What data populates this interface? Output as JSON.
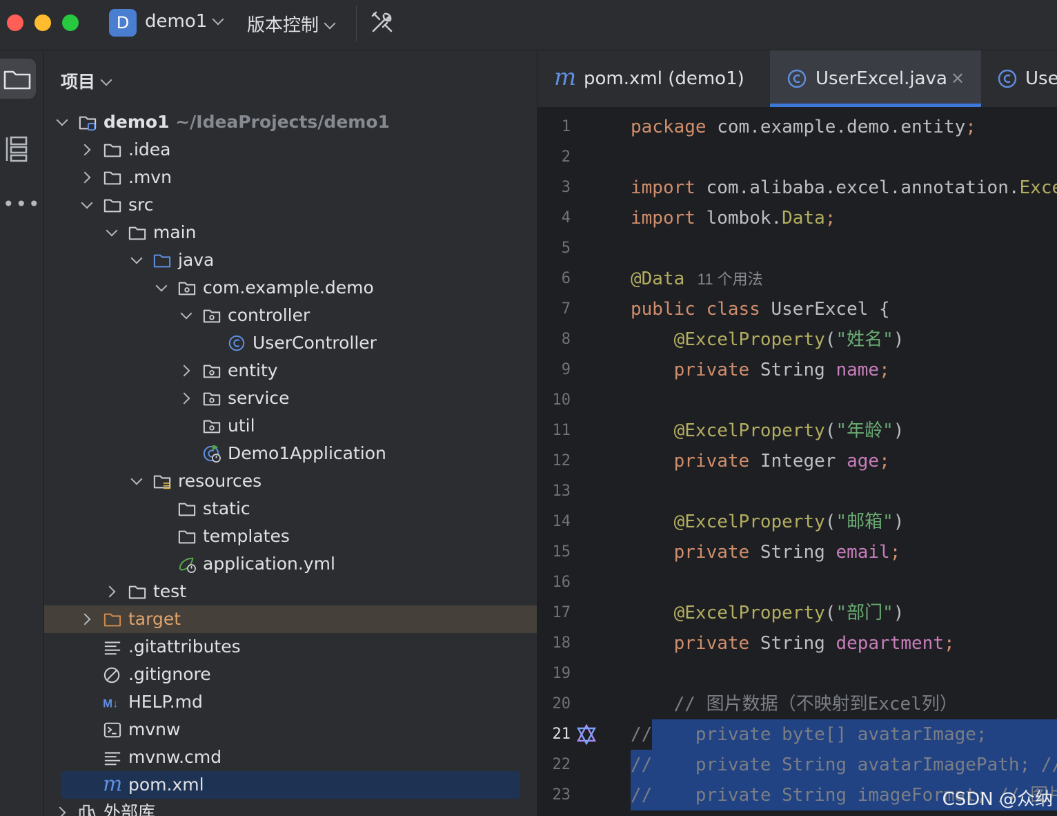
{
  "titlebar": {
    "project_badge": "D",
    "project_name": "demo1",
    "vcs_label": "版本控制"
  },
  "panel": {
    "title": "项目",
    "tree": [
      {
        "label": "demo1",
        "extra": " ~/IdeaProjects/demo1",
        "indent": 0,
        "arrow": "open",
        "icon": "module-folder"
      },
      {
        "label": ".idea",
        "indent": 1,
        "arrow": "closed",
        "icon": "folder"
      },
      {
        "label": ".mvn",
        "indent": 1,
        "arrow": "closed",
        "icon": "folder"
      },
      {
        "label": "src",
        "indent": 1,
        "arrow": "open",
        "icon": "folder"
      },
      {
        "label": "main",
        "indent": 2,
        "arrow": "open",
        "icon": "folder"
      },
      {
        "label": "java",
        "indent": 3,
        "arrow": "open",
        "icon": "source-folder"
      },
      {
        "label": "com.example.demo",
        "indent": 4,
        "arrow": "open",
        "icon": "package"
      },
      {
        "label": "controller",
        "indent": 5,
        "arrow": "open",
        "icon": "package"
      },
      {
        "label": "UserController",
        "indent": 6,
        "arrow": "none",
        "icon": "class"
      },
      {
        "label": "entity",
        "indent": 5,
        "arrow": "closed",
        "icon": "package"
      },
      {
        "label": "service",
        "indent": 5,
        "arrow": "closed",
        "icon": "package"
      },
      {
        "label": "util",
        "indent": 5,
        "arrow": "none",
        "icon": "package"
      },
      {
        "label": "Demo1Application",
        "indent": 5,
        "arrow": "none",
        "icon": "app-class"
      },
      {
        "label": "resources",
        "indent": 3,
        "arrow": "open",
        "icon": "resources-folder"
      },
      {
        "label": "static",
        "indent": 4,
        "arrow": "none",
        "icon": "folder"
      },
      {
        "label": "templates",
        "indent": 4,
        "arrow": "none",
        "icon": "folder"
      },
      {
        "label": "application.yml",
        "indent": 4,
        "arrow": "none",
        "icon": "spring-config"
      },
      {
        "label": "test",
        "indent": 2,
        "arrow": "closed",
        "icon": "folder"
      },
      {
        "label": "target",
        "indent": 1,
        "arrow": "closed",
        "icon": "excluded-folder"
      },
      {
        "label": ".gitattributes",
        "indent": 1,
        "arrow": "none",
        "icon": "text-file"
      },
      {
        "label": ".gitignore",
        "indent": 1,
        "arrow": "none",
        "icon": "ignore-file"
      },
      {
        "label": "HELP.md",
        "indent": 1,
        "arrow": "none",
        "icon": "markdown"
      },
      {
        "label": "mvnw",
        "indent": 1,
        "arrow": "none",
        "icon": "shell-script"
      },
      {
        "label": "mvnw.cmd",
        "indent": 1,
        "arrow": "none",
        "icon": "text-file"
      },
      {
        "label": "pom.xml",
        "indent": 1,
        "arrow": "none",
        "icon": "maven"
      },
      {
        "label": "外部库",
        "indent": 0,
        "arrow": "closed",
        "icon": "library"
      }
    ]
  },
  "editor": {
    "tabs": [
      {
        "label": "pom.xml (demo1)",
        "icon": "maven-icon"
      },
      {
        "label": "UserExcel.java",
        "icon": "class-icon",
        "active": true
      },
      {
        "label": "Use",
        "icon": "class-icon"
      }
    ],
    "code_lines": [
      {
        "n": "1",
        "tokens": [
          [
            "kw",
            "package"
          ],
          [
            "pl",
            " com.example.demo.entity"
          ],
          [
            "kw",
            ";"
          ]
        ]
      },
      {
        "n": "2",
        "tokens": []
      },
      {
        "n": "3",
        "tokens": [
          [
            "kw",
            "import"
          ],
          [
            "pl",
            " com.alibaba.excel.annotation."
          ],
          [
            "an",
            "Exce"
          ]
        ]
      },
      {
        "n": "4",
        "tokens": [
          [
            "kw",
            "import"
          ],
          [
            "pl",
            " lombok."
          ],
          [
            "an",
            "Data"
          ],
          [
            "kw",
            ";"
          ]
        ]
      },
      {
        "n": "5",
        "tokens": []
      },
      {
        "n": "6",
        "tokens": [
          [
            "an",
            "@Data"
          ],
          [
            "hint",
            "   11 个用法"
          ]
        ]
      },
      {
        "n": "7",
        "tokens": [
          [
            "kw",
            "public class"
          ],
          [
            "pl",
            " UserExcel {"
          ]
        ]
      },
      {
        "n": "8",
        "tokens": [
          [
            "pl",
            "    "
          ],
          [
            "an",
            "@ExcelProperty"
          ],
          [
            "pl",
            "("
          ],
          [
            "str",
            "\"姓名\""
          ],
          [
            "pl",
            ")"
          ]
        ]
      },
      {
        "n": "9",
        "tokens": [
          [
            "pl",
            "    "
          ],
          [
            "kw",
            "private"
          ],
          [
            "pl",
            " String "
          ],
          [
            "fld",
            "name"
          ],
          [
            "kw",
            ";"
          ]
        ]
      },
      {
        "n": "10",
        "tokens": []
      },
      {
        "n": "11",
        "tokens": [
          [
            "pl",
            "    "
          ],
          [
            "an",
            "@ExcelProperty"
          ],
          [
            "pl",
            "("
          ],
          [
            "str",
            "\"年龄\""
          ],
          [
            "pl",
            ")"
          ]
        ]
      },
      {
        "n": "12",
        "tokens": [
          [
            "pl",
            "    "
          ],
          [
            "kw",
            "private"
          ],
          [
            "pl",
            " Integer "
          ],
          [
            "fld",
            "age"
          ],
          [
            "kw",
            ";"
          ]
        ]
      },
      {
        "n": "13",
        "tokens": []
      },
      {
        "n": "14",
        "tokens": [
          [
            "pl",
            "    "
          ],
          [
            "an",
            "@ExcelProperty"
          ],
          [
            "pl",
            "("
          ],
          [
            "str",
            "\"邮箱\""
          ],
          [
            "pl",
            ")"
          ]
        ]
      },
      {
        "n": "15",
        "tokens": [
          [
            "pl",
            "    "
          ],
          [
            "kw",
            "private"
          ],
          [
            "pl",
            " String "
          ],
          [
            "fld",
            "email"
          ],
          [
            "kw",
            ";"
          ]
        ]
      },
      {
        "n": "16",
        "tokens": []
      },
      {
        "n": "17",
        "tokens": [
          [
            "pl",
            "    "
          ],
          [
            "an",
            "@ExcelProperty"
          ],
          [
            "pl",
            "("
          ],
          [
            "str",
            "\"部门\""
          ],
          [
            "pl",
            ")"
          ]
        ]
      },
      {
        "n": "18",
        "tokens": [
          [
            "pl",
            "    "
          ],
          [
            "kw",
            "private"
          ],
          [
            "pl",
            " String "
          ],
          [
            "fld",
            "department"
          ],
          [
            "kw",
            ";"
          ]
        ]
      },
      {
        "n": "19",
        "tokens": []
      },
      {
        "n": "20",
        "tokens": [
          [
            "cm",
            "    // 图片数据（不映射到Excel列）"
          ]
        ]
      },
      {
        "n": "21",
        "tokens": [
          [
            "cm",
            "//    private byte[] avatarImage;"
          ]
        ],
        "selected": true,
        "current": true
      },
      {
        "n": "22",
        "tokens": [
          [
            "cm",
            "//    private String avatarImagePath; //"
          ]
        ],
        "selected": true
      },
      {
        "n": "23",
        "tokens": [
          [
            "cm",
            "//    private String imageFormat; // 图片"
          ]
        ],
        "selected": true
      }
    ]
  },
  "watermark": "CSDN @众纳"
}
